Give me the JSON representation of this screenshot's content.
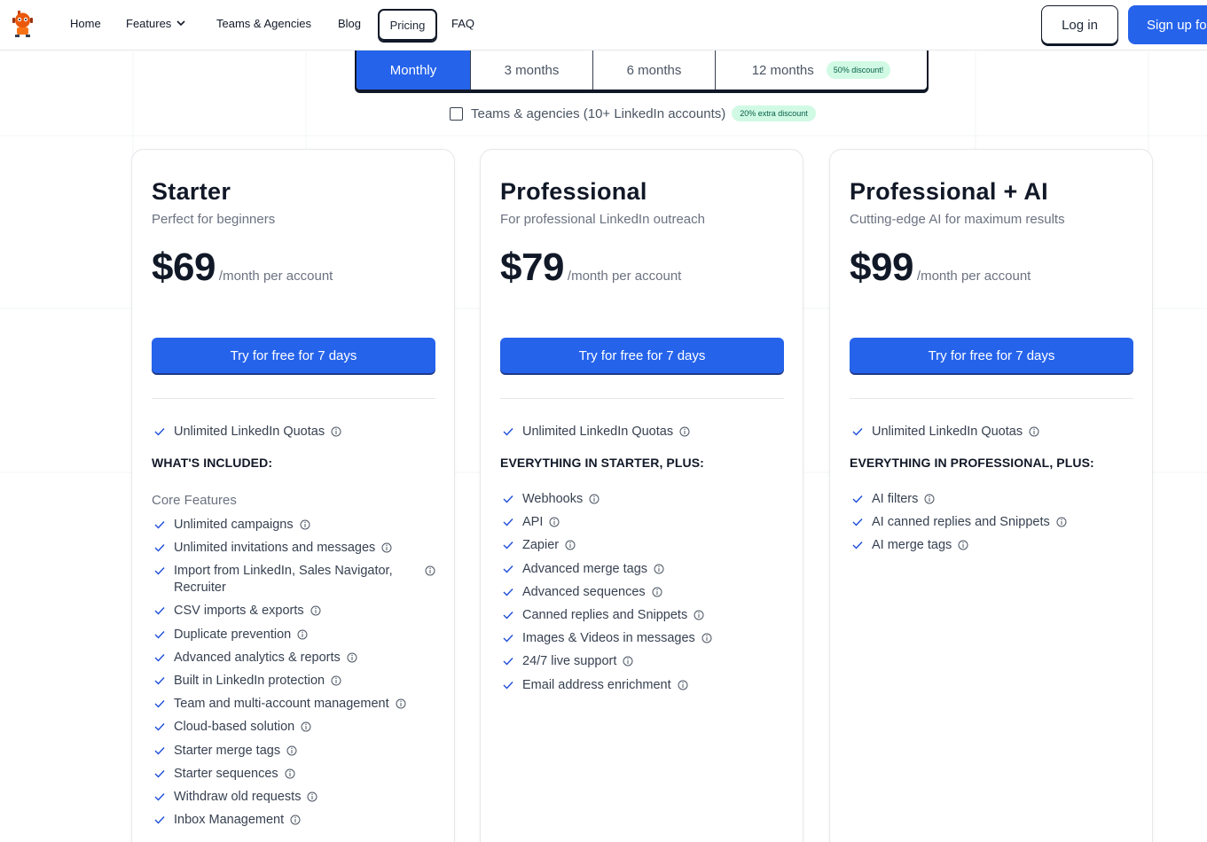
{
  "nav": {
    "links": [
      "Home",
      "Features",
      "Teams & Agencies",
      "Blog"
    ],
    "pricing": "Pricing",
    "faq": "FAQ",
    "login": "Log in",
    "signup": "Sign up fo"
  },
  "durations": {
    "tabs": [
      "Monthly",
      "3 months",
      "6 months",
      "12 months"
    ],
    "active": "Monthly",
    "discount_badge": "50% discount!"
  },
  "teams_toggle": {
    "label": "Teams & agencies (10+ LinkedIn accounts)",
    "badge": "20% extra discount",
    "checked": false
  },
  "colors": {
    "accent": "#2563eb",
    "badge_bg": "#d1fae5"
  },
  "plans": [
    {
      "name": "Starter",
      "subtitle": "Perfect for beginners",
      "price": "$69",
      "price_unit": "/month per account",
      "cta": "Try for free for 7 days",
      "quota": "Unlimited LinkedIn Quotas",
      "section": "WHAT'S INCLUDED:",
      "group": "Core Features",
      "features": [
        "Unlimited campaigns",
        "Unlimited invitations and messages",
        "Import from LinkedIn, Sales Navigator, Recruiter",
        "CSV imports & exports",
        "Duplicate prevention",
        "Advanced analytics & reports",
        "Built in LinkedIn protection",
        "Team and multi-account management",
        "Cloud-based solution",
        "Starter merge tags",
        "Starter sequences",
        "Withdraw old requests",
        "Inbox Management"
      ]
    },
    {
      "name": "Professional",
      "subtitle": "For professional LinkedIn outreach",
      "price": "$79",
      "price_unit": "/month per account",
      "cta": "Try for free for 7 days",
      "quota": "Unlimited LinkedIn Quotas",
      "section": "EVERYTHING IN STARTER, PLUS:",
      "features": [
        "Webhooks",
        "API",
        "Zapier",
        "Advanced merge tags",
        "Advanced sequences",
        "Canned replies and Snippets",
        "Images & Videos in messages",
        "24/7 live support",
        "Email address enrichment"
      ]
    },
    {
      "name": "Professional + AI",
      "subtitle": "Cutting-edge AI for maximum results",
      "price": "$99",
      "price_unit": "/month per account",
      "cta": "Try for free for 7 days",
      "quota": "Unlimited LinkedIn Quotas",
      "section": "EVERYTHING IN PROFESSIONAL, PLUS:",
      "features": [
        "AI filters",
        "AI canned replies and Snippets",
        "AI merge tags"
      ]
    }
  ]
}
